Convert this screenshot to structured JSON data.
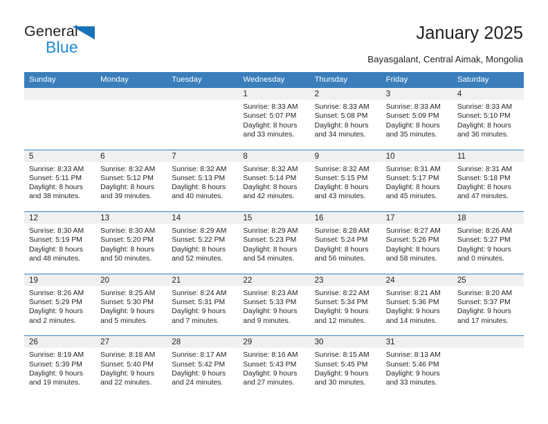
{
  "brand": {
    "name_part1": "General",
    "name_part2": "Blue",
    "colors": {
      "triangle": "#1972b8",
      "blue_text": "#1d8ad6",
      "header_blue": "#3b7ebc",
      "day_band": "#f0f0f0"
    }
  },
  "header": {
    "title": "January 2025",
    "subtitle": "Bayasgalant, Central Aimak, Mongolia"
  },
  "calendar": {
    "weekday_headers": [
      "Sunday",
      "Monday",
      "Tuesday",
      "Wednesday",
      "Thursday",
      "Friday",
      "Saturday"
    ],
    "weeks": [
      [
        {
          "day": "",
          "sunrise": "",
          "sunset": "",
          "daylight_line1": "",
          "daylight_line2": ""
        },
        {
          "day": "",
          "sunrise": "",
          "sunset": "",
          "daylight_line1": "",
          "daylight_line2": ""
        },
        {
          "day": "",
          "sunrise": "",
          "sunset": "",
          "daylight_line1": "",
          "daylight_line2": ""
        },
        {
          "day": "1",
          "sunrise": "Sunrise: 8:33 AM",
          "sunset": "Sunset: 5:07 PM",
          "daylight_line1": "Daylight: 8 hours",
          "daylight_line2": "and 33 minutes."
        },
        {
          "day": "2",
          "sunrise": "Sunrise: 8:33 AM",
          "sunset": "Sunset: 5:08 PM",
          "daylight_line1": "Daylight: 8 hours",
          "daylight_line2": "and 34 minutes."
        },
        {
          "day": "3",
          "sunrise": "Sunrise: 8:33 AM",
          "sunset": "Sunset: 5:09 PM",
          "daylight_line1": "Daylight: 8 hours",
          "daylight_line2": "and 35 minutes."
        },
        {
          "day": "4",
          "sunrise": "Sunrise: 8:33 AM",
          "sunset": "Sunset: 5:10 PM",
          "daylight_line1": "Daylight: 8 hours",
          "daylight_line2": "and 36 minutes."
        }
      ],
      [
        {
          "day": "5",
          "sunrise": "Sunrise: 8:33 AM",
          "sunset": "Sunset: 5:11 PM",
          "daylight_line1": "Daylight: 8 hours",
          "daylight_line2": "and 38 minutes."
        },
        {
          "day": "6",
          "sunrise": "Sunrise: 8:32 AM",
          "sunset": "Sunset: 5:12 PM",
          "daylight_line1": "Daylight: 8 hours",
          "daylight_line2": "and 39 minutes."
        },
        {
          "day": "7",
          "sunrise": "Sunrise: 8:32 AM",
          "sunset": "Sunset: 5:13 PM",
          "daylight_line1": "Daylight: 8 hours",
          "daylight_line2": "and 40 minutes."
        },
        {
          "day": "8",
          "sunrise": "Sunrise: 8:32 AM",
          "sunset": "Sunset: 5:14 PM",
          "daylight_line1": "Daylight: 8 hours",
          "daylight_line2": "and 42 minutes."
        },
        {
          "day": "9",
          "sunrise": "Sunrise: 8:32 AM",
          "sunset": "Sunset: 5:15 PM",
          "daylight_line1": "Daylight: 8 hours",
          "daylight_line2": "and 43 minutes."
        },
        {
          "day": "10",
          "sunrise": "Sunrise: 8:31 AM",
          "sunset": "Sunset: 5:17 PM",
          "daylight_line1": "Daylight: 8 hours",
          "daylight_line2": "and 45 minutes."
        },
        {
          "day": "11",
          "sunrise": "Sunrise: 8:31 AM",
          "sunset": "Sunset: 5:18 PM",
          "daylight_line1": "Daylight: 8 hours",
          "daylight_line2": "and 47 minutes."
        }
      ],
      [
        {
          "day": "12",
          "sunrise": "Sunrise: 8:30 AM",
          "sunset": "Sunset: 5:19 PM",
          "daylight_line1": "Daylight: 8 hours",
          "daylight_line2": "and 48 minutes."
        },
        {
          "day": "13",
          "sunrise": "Sunrise: 8:30 AM",
          "sunset": "Sunset: 5:20 PM",
          "daylight_line1": "Daylight: 8 hours",
          "daylight_line2": "and 50 minutes."
        },
        {
          "day": "14",
          "sunrise": "Sunrise: 8:29 AM",
          "sunset": "Sunset: 5:22 PM",
          "daylight_line1": "Daylight: 8 hours",
          "daylight_line2": "and 52 minutes."
        },
        {
          "day": "15",
          "sunrise": "Sunrise: 8:29 AM",
          "sunset": "Sunset: 5:23 PM",
          "daylight_line1": "Daylight: 8 hours",
          "daylight_line2": "and 54 minutes."
        },
        {
          "day": "16",
          "sunrise": "Sunrise: 8:28 AM",
          "sunset": "Sunset: 5:24 PM",
          "daylight_line1": "Daylight: 8 hours",
          "daylight_line2": "and 56 minutes."
        },
        {
          "day": "17",
          "sunrise": "Sunrise: 8:27 AM",
          "sunset": "Sunset: 5:26 PM",
          "daylight_line1": "Daylight: 8 hours",
          "daylight_line2": "and 58 minutes."
        },
        {
          "day": "18",
          "sunrise": "Sunrise: 8:26 AM",
          "sunset": "Sunset: 5:27 PM",
          "daylight_line1": "Daylight: 9 hours",
          "daylight_line2": "and 0 minutes."
        }
      ],
      [
        {
          "day": "19",
          "sunrise": "Sunrise: 8:26 AM",
          "sunset": "Sunset: 5:29 PM",
          "daylight_line1": "Daylight: 9 hours",
          "daylight_line2": "and 2 minutes."
        },
        {
          "day": "20",
          "sunrise": "Sunrise: 8:25 AM",
          "sunset": "Sunset: 5:30 PM",
          "daylight_line1": "Daylight: 9 hours",
          "daylight_line2": "and 5 minutes."
        },
        {
          "day": "21",
          "sunrise": "Sunrise: 8:24 AM",
          "sunset": "Sunset: 5:31 PM",
          "daylight_line1": "Daylight: 9 hours",
          "daylight_line2": "and 7 minutes."
        },
        {
          "day": "22",
          "sunrise": "Sunrise: 8:23 AM",
          "sunset": "Sunset: 5:33 PM",
          "daylight_line1": "Daylight: 9 hours",
          "daylight_line2": "and 9 minutes."
        },
        {
          "day": "23",
          "sunrise": "Sunrise: 8:22 AM",
          "sunset": "Sunset: 5:34 PM",
          "daylight_line1": "Daylight: 9 hours",
          "daylight_line2": "and 12 minutes."
        },
        {
          "day": "24",
          "sunrise": "Sunrise: 8:21 AM",
          "sunset": "Sunset: 5:36 PM",
          "daylight_line1": "Daylight: 9 hours",
          "daylight_line2": "and 14 minutes."
        },
        {
          "day": "25",
          "sunrise": "Sunrise: 8:20 AM",
          "sunset": "Sunset: 5:37 PM",
          "daylight_line1": "Daylight: 9 hours",
          "daylight_line2": "and 17 minutes."
        }
      ],
      [
        {
          "day": "26",
          "sunrise": "Sunrise: 8:19 AM",
          "sunset": "Sunset: 5:39 PM",
          "daylight_line1": "Daylight: 9 hours",
          "daylight_line2": "and 19 minutes."
        },
        {
          "day": "27",
          "sunrise": "Sunrise: 8:18 AM",
          "sunset": "Sunset: 5:40 PM",
          "daylight_line1": "Daylight: 9 hours",
          "daylight_line2": "and 22 minutes."
        },
        {
          "day": "28",
          "sunrise": "Sunrise: 8:17 AM",
          "sunset": "Sunset: 5:42 PM",
          "daylight_line1": "Daylight: 9 hours",
          "daylight_line2": "and 24 minutes."
        },
        {
          "day": "29",
          "sunrise": "Sunrise: 8:16 AM",
          "sunset": "Sunset: 5:43 PM",
          "daylight_line1": "Daylight: 9 hours",
          "daylight_line2": "and 27 minutes."
        },
        {
          "day": "30",
          "sunrise": "Sunrise: 8:15 AM",
          "sunset": "Sunset: 5:45 PM",
          "daylight_line1": "Daylight: 9 hours",
          "daylight_line2": "and 30 minutes."
        },
        {
          "day": "31",
          "sunrise": "Sunrise: 8:13 AM",
          "sunset": "Sunset: 5:46 PM",
          "daylight_line1": "Daylight: 9 hours",
          "daylight_line2": "and 33 minutes."
        },
        {
          "day": "",
          "sunrise": "",
          "sunset": "",
          "daylight_line1": "",
          "daylight_line2": ""
        }
      ]
    ]
  }
}
